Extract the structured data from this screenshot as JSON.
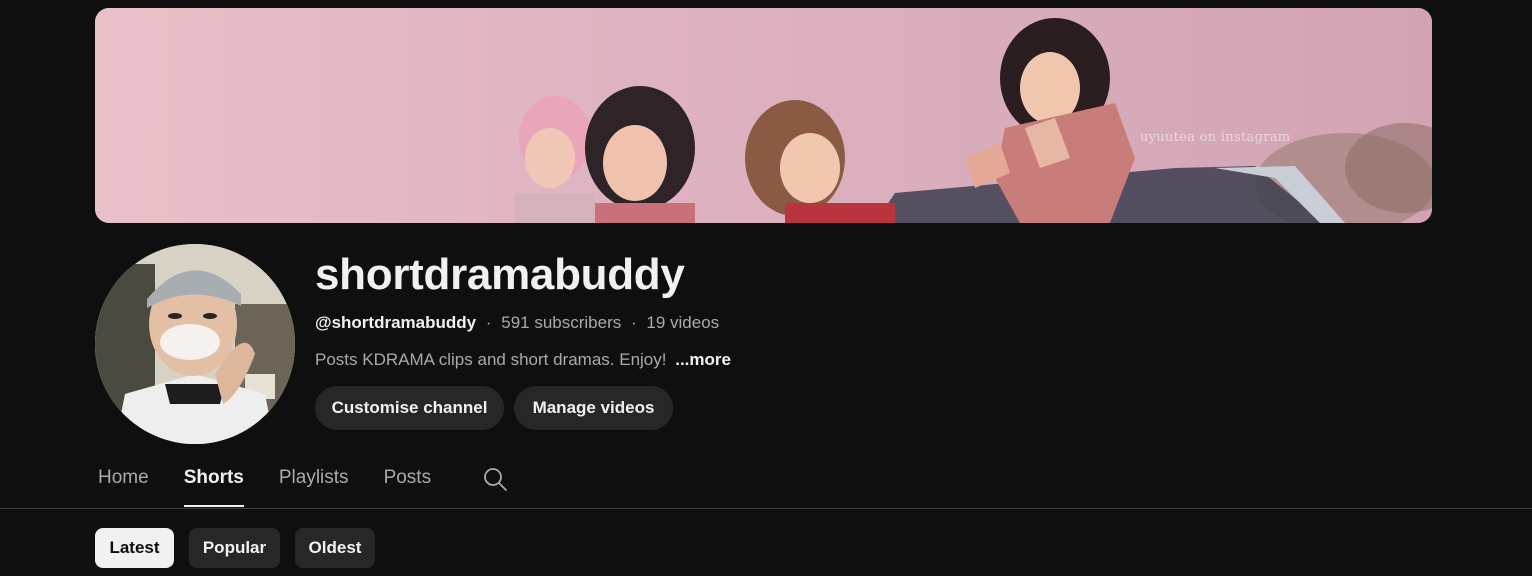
{
  "banner": {
    "watermark": "uyuutea on instagram"
  },
  "channel": {
    "name": "shortdramabuddy",
    "handle": "@shortdramabuddy",
    "subscribers": "591 subscribers",
    "videos": "19 videos",
    "separator": "·",
    "description": "Posts KDRAMA clips and short dramas. Enjoy!",
    "more_label": "...more"
  },
  "actions": {
    "customise_label": "Customise channel",
    "manage_label": "Manage videos"
  },
  "tabs": [
    {
      "label": "Home",
      "active": false
    },
    {
      "label": "Shorts",
      "active": true
    },
    {
      "label": "Playlists",
      "active": false
    },
    {
      "label": "Posts",
      "active": false
    }
  ],
  "search_icon": "search-icon",
  "sort_chips": [
    {
      "label": "Latest",
      "selected": true
    },
    {
      "label": "Popular",
      "selected": false
    },
    {
      "label": "Oldest",
      "selected": false
    }
  ],
  "colors": {
    "background": "#0f0f0f",
    "chip_background": "#272727",
    "selected_chip": "#f1f1f1",
    "secondary_text": "#aaaaaa"
  }
}
